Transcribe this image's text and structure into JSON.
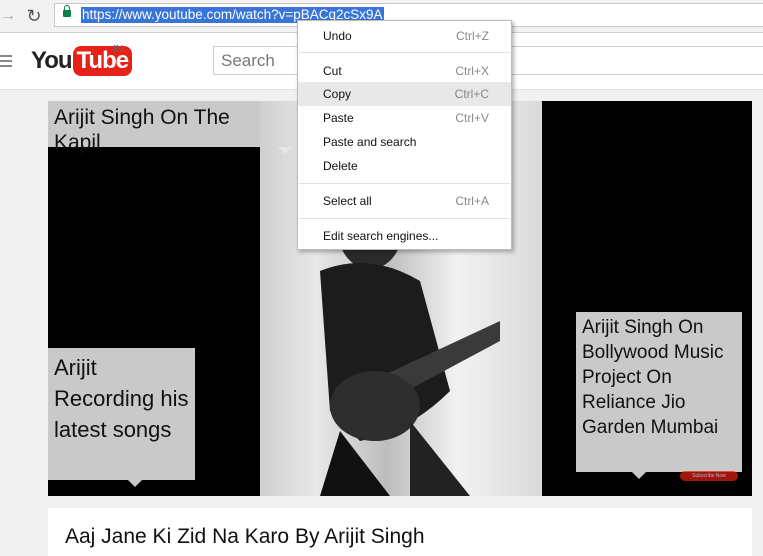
{
  "browser": {
    "url": "https://www.youtube.com/watch?v=pBACq2cSx9A"
  },
  "youtube": {
    "logo_you": "You",
    "logo_tube": "Tube",
    "logo_country": "IN",
    "search_placeholder": "Search"
  },
  "video": {
    "annotation_top": "Arijit Singh On The Kapil",
    "annotation_left": "Arijit Recording his latest songs",
    "annotation_right": "Arijit Singh On Bollywood Music Project On Reliance Jio Garden Mumbai",
    "subscribe_label": "Subscribe Now",
    "title": "Aaj Jane Ki Zid Na Karo By Arijit Singh"
  },
  "context_menu": {
    "undo": {
      "label": "Undo",
      "shortcut": "Ctrl+Z"
    },
    "cut": {
      "label": "Cut",
      "shortcut": "Ctrl+X"
    },
    "copy": {
      "label": "Copy",
      "shortcut": "Ctrl+C"
    },
    "paste": {
      "label": "Paste",
      "shortcut": "Ctrl+V"
    },
    "paste_and_search": {
      "label": "Paste and search"
    },
    "delete": {
      "label": "Delete"
    },
    "select_all": {
      "label": "Select all",
      "shortcut": "Ctrl+A"
    },
    "edit_search_engines": {
      "label": "Edit search engines..."
    },
    "highlighted_item": "Copy"
  },
  "colors": {
    "brand_red": "#e62117",
    "selection_blue": "#3875d7",
    "lock_green": "#0b8043"
  }
}
